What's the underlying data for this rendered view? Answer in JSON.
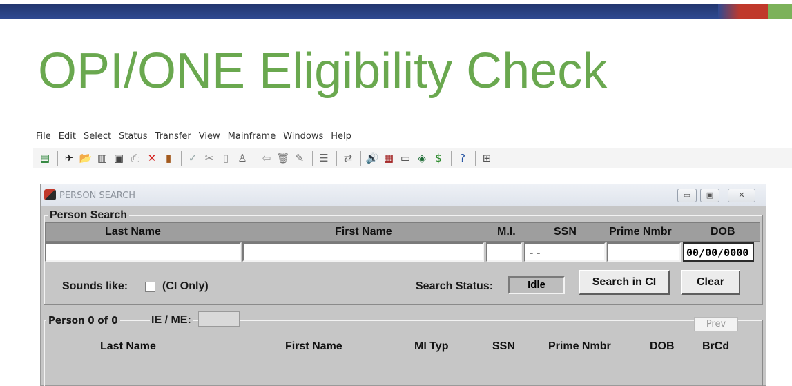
{
  "slide": {
    "title": "OPI/ONE Eligibility Check",
    "colors": {
      "title": "#6aa84f",
      "band_blue": "#2f4a92",
      "band_red": "#c0392b",
      "band_green": "#7cb25a"
    }
  },
  "menu": [
    "File",
    "Edit",
    "Select",
    "Status",
    "Transfer",
    "View",
    "Mainframe",
    "Windows",
    "Help"
  ],
  "toolbar": {
    "icons": [
      {
        "name": "terminal-icon",
        "glyph": "▤",
        "color": "#1e7b2c"
      },
      {
        "name": "sep"
      },
      {
        "name": "runner-icon",
        "glyph": "✈",
        "color": "#222"
      },
      {
        "name": "open-folder-icon",
        "glyph": "📂",
        "color": "#d9a51b"
      },
      {
        "name": "save-session-icon",
        "glyph": "▥",
        "color": "#555"
      },
      {
        "name": "floppy-icon",
        "glyph": "▣",
        "color": "#444"
      },
      {
        "name": "print-icon",
        "glyph": "⎙",
        "color": "#888"
      },
      {
        "name": "close-red-x-icon",
        "glyph": "✕",
        "color": "#d4201e"
      },
      {
        "name": "exit-door-icon",
        "glyph": "▮",
        "color": "#a35a1e"
      },
      {
        "name": "sep"
      },
      {
        "name": "check-icon",
        "glyph": "✓",
        "color": "#9aa"
      },
      {
        "name": "cut-icon",
        "glyph": "✂",
        "color": "#888"
      },
      {
        "name": "copy-icon",
        "glyph": "▯",
        "color": "#999"
      },
      {
        "name": "paste-icon",
        "glyph": "♙",
        "color": "#666"
      },
      {
        "name": "sep"
      },
      {
        "name": "back-icon",
        "glyph": "⇦",
        "color": "#999"
      },
      {
        "name": "trash-icon",
        "glyph": "🗑",
        "color": "#777"
      },
      {
        "name": "pencil-icon",
        "glyph": "✎",
        "color": "#777"
      },
      {
        "name": "sep"
      },
      {
        "name": "stack-icon",
        "glyph": "☰",
        "color": "#666"
      },
      {
        "name": "sep"
      },
      {
        "name": "transfer-icon",
        "glyph": "⇄",
        "color": "#666"
      },
      {
        "name": "sep"
      },
      {
        "name": "speaker-icon",
        "glyph": "🔊",
        "color": "#333"
      },
      {
        "name": "grid-icon",
        "glyph": "▦",
        "color": "#a01e1e"
      },
      {
        "name": "book-icon",
        "glyph": "▭",
        "color": "#444"
      },
      {
        "name": "green-book-icon",
        "glyph": "◈",
        "color": "#1d6b34"
      },
      {
        "name": "dollar-icon",
        "glyph": "$",
        "color": "#2b8a2b"
      },
      {
        "name": "sep"
      },
      {
        "name": "help-icon",
        "glyph": "?",
        "color": "#1f4fa0"
      },
      {
        "name": "sep"
      },
      {
        "name": "network-icon",
        "glyph": "⊞",
        "color": "#555"
      }
    ]
  },
  "window": {
    "title": "PERSON SEARCH",
    "buttons": {
      "minimize": "▭",
      "maximize": "▣",
      "close": "✕"
    }
  },
  "person_search": {
    "group_label": "Person Search",
    "columns": [
      "Last Name",
      "First Name",
      "M.I.",
      "SSN",
      "Prime Nmbr",
      "DOB"
    ],
    "fields": {
      "last_name": "",
      "first_name": "",
      "mi": "",
      "ssn": "- -",
      "prime_nmbr": "",
      "dob": "00/00/0000"
    },
    "sounds_like_label": "Sounds like:",
    "sounds_like_checked": false,
    "ci_only_label": "(CI Only)",
    "search_status_label": "Search Status:",
    "search_status_value": "Idle",
    "search_button": "Search in CI",
    "clear_button": "Clear"
  },
  "results": {
    "person_count_label": "Person 0 of 0",
    "ie_me_label": "IE / ME:",
    "ie_me_value": "",
    "prev_button": "Prev",
    "columns": [
      "Last Name",
      "First Name",
      "MI Typ",
      "SSN",
      "Prime Nmbr",
      "DOB",
      "BrCd"
    ]
  }
}
